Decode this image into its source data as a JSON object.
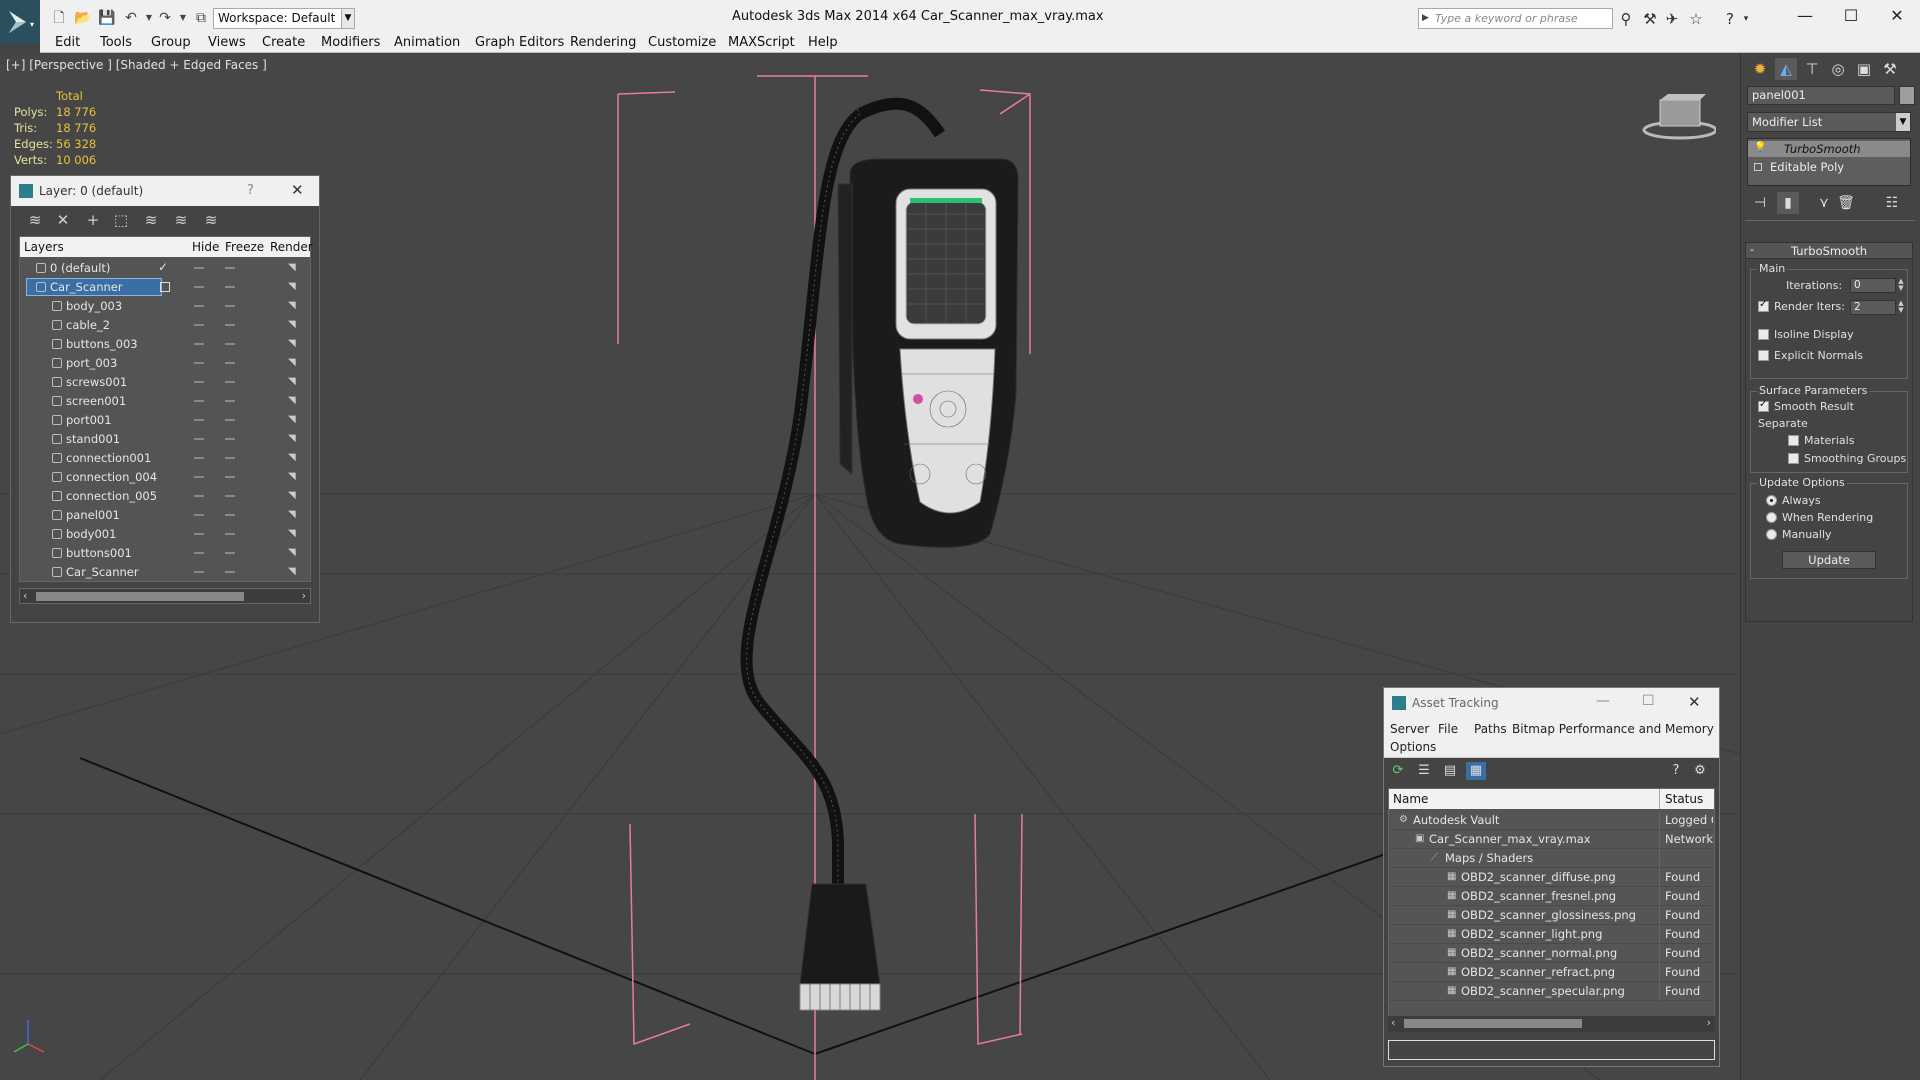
{
  "app": {
    "title": "Autodesk 3ds Max  2014 x64      Car_Scanner_max_vray.max",
    "workspace": "Workspace: Default",
    "search_placeholder": "Type a keyword or phrase"
  },
  "menu": [
    "Edit",
    "Tools",
    "Group",
    "Views",
    "Create",
    "Modifiers",
    "Animation",
    "Graph Editors",
    "Rendering",
    "Customize",
    "MAXScript",
    "Help"
  ],
  "viewport": {
    "label": "[+] [Perspective ] [Shaded + Edged Faces ]",
    "stats_header": "Total",
    "stats": [
      {
        "key": "Polys:",
        "value": "18 776"
      },
      {
        "key": "Tris:",
        "value": "18 776"
      },
      {
        "key": "Edges:",
        "value": "56 328"
      },
      {
        "key": "Verts:",
        "value": "10 006"
      }
    ]
  },
  "layer_panel": {
    "title": "Layer: 0 (default)",
    "help": "?",
    "columns": {
      "layers": "Layers",
      "hide": "Hide",
      "freeze": "Freeze",
      "render": "Render"
    },
    "rows": [
      {
        "name": "0 (default)",
        "level": 0
      },
      {
        "name": "Car_Scanner",
        "level": 0
      },
      {
        "name": "body_003",
        "level": 1
      },
      {
        "name": "cable_2",
        "level": 1
      },
      {
        "name": "buttons_003",
        "level": 1
      },
      {
        "name": "port_003",
        "level": 1
      },
      {
        "name": "screws001",
        "level": 1
      },
      {
        "name": "screen001",
        "level": 1
      },
      {
        "name": "port001",
        "level": 1
      },
      {
        "name": "stand001",
        "level": 1
      },
      {
        "name": "connection001",
        "level": 1
      },
      {
        "name": "connection_004",
        "level": 1
      },
      {
        "name": "connection_005",
        "level": 1
      },
      {
        "name": "panel001",
        "level": 1
      },
      {
        "name": "body001",
        "level": 1
      },
      {
        "name": "buttons001",
        "level": 1
      },
      {
        "name": "Car_Scanner",
        "level": 1
      }
    ]
  },
  "command_panel": {
    "object_name": "panel001",
    "modifier_list": "Modifier List",
    "stack": [
      "TurboSmooth",
      "Editable Poly"
    ],
    "turbosmooth": {
      "title": "TurboSmooth",
      "main": "Main",
      "iterations_label": "Iterations:",
      "iterations_value": "0",
      "render_iters_label": "Render Iters:",
      "render_iters_value": "2",
      "isoline": "Isoline Display",
      "explicit_normals": "Explicit Normals",
      "surface_params": "Surface Parameters",
      "smooth_result": "Smooth Result",
      "separate": "Separate",
      "materials": "Materials",
      "smoothing_groups": "Smoothing Groups",
      "update_options": "Update Options",
      "always": "Always",
      "when_rendering": "When Rendering",
      "manually": "Manually",
      "update_button": "Update"
    }
  },
  "asset_tracking": {
    "title": "Asset Tracking",
    "menu": [
      "Server",
      "File",
      "Paths",
      "Bitmap Performance and Memory",
      "Options"
    ],
    "columns": {
      "name": "Name",
      "status": "Status"
    },
    "rows": [
      {
        "name": "Autodesk Vault",
        "status": "Logged O",
        "level": 0
      },
      {
        "name": "Car_Scanner_max_vray.max",
        "status": "Network I",
        "level": 1
      },
      {
        "name": "Maps / Shaders",
        "status": "",
        "level": 2
      },
      {
        "name": "OBD2_scanner_diffuse.png",
        "status": "Found",
        "level": 3
      },
      {
        "name": "OBD2_scanner_fresnel.png",
        "status": "Found",
        "level": 3
      },
      {
        "name": "OBD2_scanner_glossiness.png",
        "status": "Found",
        "level": 3
      },
      {
        "name": "OBD2_scanner_light.png",
        "status": "Found",
        "level": 3
      },
      {
        "name": "OBD2_scanner_normal.png",
        "status": "Found",
        "level": 3
      },
      {
        "name": "OBD2_scanner_refract.png",
        "status": "Found",
        "level": 3
      },
      {
        "name": "OBD2_scanner_specular.png",
        "status": "Found",
        "level": 3
      }
    ]
  },
  "colors": {
    "accent_selection": "#3a6ea5",
    "stats": "#e8c23a",
    "gizmo": "#e87aa8"
  }
}
